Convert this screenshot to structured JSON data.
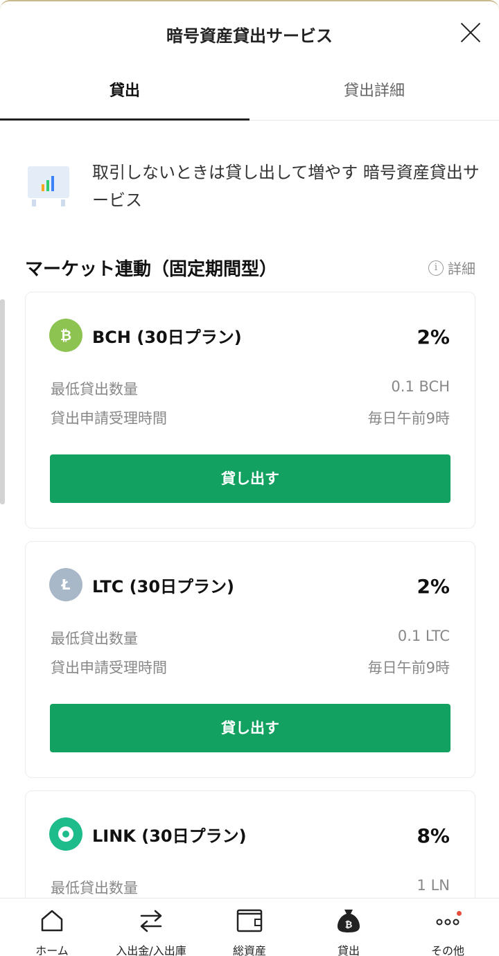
{
  "header": {
    "title": "暗号資産貸出サービス"
  },
  "tabs": [
    {
      "label": "貸出",
      "active": true
    },
    {
      "label": "貸出詳細",
      "active": false
    }
  ],
  "promo": {
    "text": "取引しないときは貸し出して増やす 暗号資産貸出サービス",
    "icon": "bar-chart-board-icon"
  },
  "section": {
    "title": "マーケット連動（固定期間型）",
    "detail_label": "詳細"
  },
  "cards": [
    {
      "coin": "BCH",
      "coin_color": "#8dc351",
      "coin_symbol": "₿",
      "name": "BCH (30日プラン)",
      "rate": "2%",
      "min_label": "最低貸出数量",
      "min_value": "0.1 BCH",
      "time_label": "貸出申請受理時間",
      "time_value": "毎日午前9時",
      "button": "貸し出す"
    },
    {
      "coin": "LTC",
      "coin_color": "#a9b8c8",
      "coin_symbol": "Ł",
      "name": "LTC (30日プラン)",
      "rate": "2%",
      "min_label": "最低貸出数量",
      "min_value": "0.1 LTC",
      "time_label": "貸出申請受理時間",
      "time_value": "毎日午前9時",
      "button": "貸し出す"
    },
    {
      "coin": "LINK",
      "coin_color": "#1ebc8a",
      "coin_symbol": "◉",
      "name": "LINK (30日プラン)",
      "rate": "8%",
      "min_label": "最低貸出数量",
      "min_value": "1 LN"
    }
  ],
  "bottom_nav": [
    {
      "label": "ホーム",
      "icon": "home-icon"
    },
    {
      "label": "入出金/入出庫",
      "icon": "transfer-arrows-icon"
    },
    {
      "label": "総資産",
      "icon": "wallet-icon"
    },
    {
      "label": "貸出",
      "icon": "coin-bag-icon",
      "active": true
    },
    {
      "label": "その他",
      "icon": "more-dots-icon"
    }
  ],
  "colors": {
    "accent": "#12a160",
    "text": "#222222",
    "muted": "#888888"
  }
}
